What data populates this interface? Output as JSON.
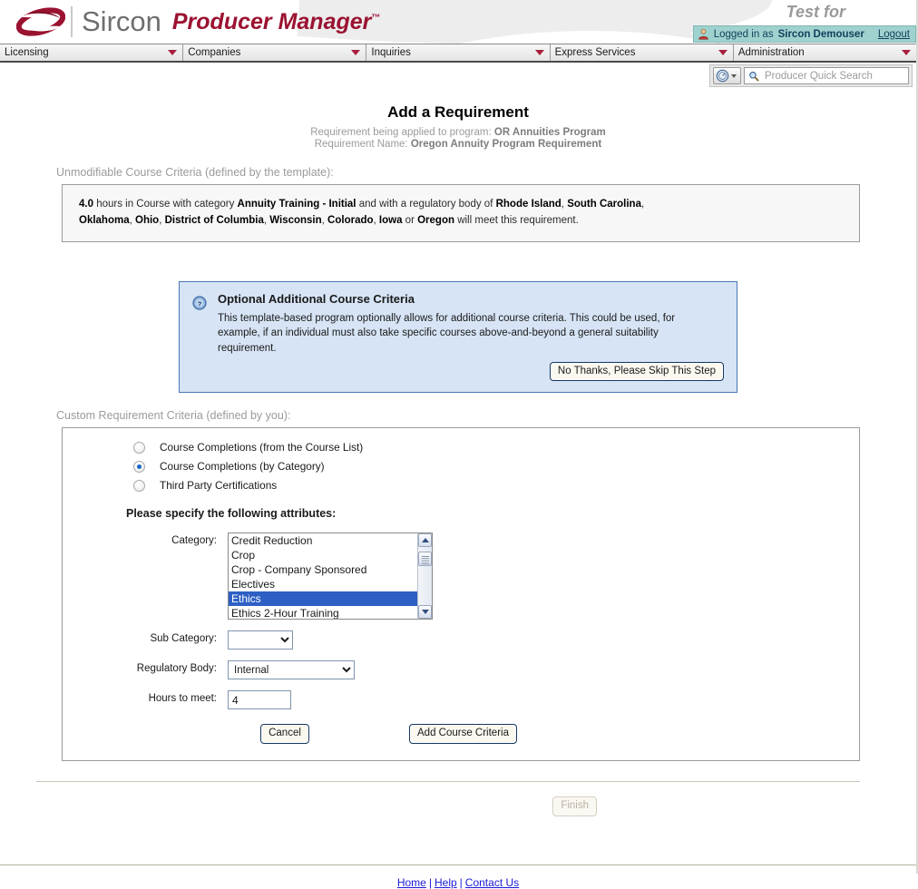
{
  "header": {
    "logo_brand": "Sircon",
    "logo_product": "Producer Manager",
    "logo_tm": "™",
    "logo_icon": "sircon-swoosh-logo",
    "test_for": "Test for",
    "logged_in_prefix": "Logged in as",
    "logged_in_user": "Sircon Demouser",
    "logout_label": "Logout",
    "person_icon": "user-icon"
  },
  "nav": {
    "items": [
      {
        "label": "Licensing"
      },
      {
        "label": "Companies"
      },
      {
        "label": "Inquiries"
      },
      {
        "label": "Express Services"
      },
      {
        "label": "Administration"
      }
    ]
  },
  "quick_search": {
    "globe_icon": "globe-icon",
    "search_icon": "search-icon",
    "placeholder": "Producer Quick Search",
    "value": ""
  },
  "page": {
    "title": "Add a Requirement",
    "subtitle_1_prefix": "Requirement being applied to program:",
    "subtitle_1_value": "OR Annuities Program",
    "subtitle_2_prefix": "Requirement Name:",
    "subtitle_2_value": "Oregon Annuity Program Requirement"
  },
  "unmodifiable": {
    "section_label": "Unmodifiable Course Criteria (defined by the template):",
    "line1_a": "4.0",
    "line1_b": " hours in Course with category ",
    "line1_c": "Annuity Training - Initial",
    "line1_d": " and with a regulatory body of ",
    "line1_e": "Rhode Island",
    "line1_f": ", ",
    "line1_g": "South Carolina",
    "line2_a": "Oklahoma",
    "line2_b": "Ohio",
    "line2_c": "District of Columbia",
    "line2_d": "Wisconsin",
    "line2_e": "Colorado",
    "line2_f": "Iowa",
    "line2_g": " or ",
    "line2_h": "Oregon",
    "line2_i": " will meet this requirement."
  },
  "info_panel": {
    "icon": "help-circle-icon",
    "title": "Optional Additional Course Criteria",
    "text": "This template-based program optionally allows for additional course criteria. This could be used, for example, if an individual must also take specific courses above-and-beyond a general suitability requirement.",
    "skip_button": "No Thanks, Please Skip This Step",
    "bg_color": "#d6e4f5",
    "border_color": "#4a77b5"
  },
  "custom": {
    "section_label": "Custom Requirement Criteria (defined by you):",
    "radios": [
      {
        "label": "Course Completions (from the Course List)",
        "checked": false
      },
      {
        "label": "Course Completions (by Category)",
        "checked": true
      },
      {
        "label": "Third Party Certifications",
        "checked": false
      }
    ],
    "attrs_title": "Please specify the following attributes:",
    "category": {
      "label": "Category:",
      "options": [
        "Credit Reduction",
        "Crop",
        "Crop - Company Sponsored",
        "Electives",
        "Ethics",
        "Ethics 2-Hour Training"
      ],
      "selected": "Ethics",
      "selected_color": "#2d5fc4"
    },
    "sub_category": {
      "label": "Sub Category:",
      "value": "",
      "options": [
        ""
      ]
    },
    "regulatory_body": {
      "label": "Regulatory Body:",
      "value": "Internal",
      "options": [
        "Internal"
      ]
    },
    "hours": {
      "label": "Hours to meet:",
      "value": "4"
    },
    "cancel_button": "Cancel",
    "add_button": "Add Course Criteria"
  },
  "footer": {
    "finish_button": "Finish",
    "finish_disabled": true,
    "links": [
      "Home",
      "Help",
      "Contact Us"
    ],
    "separator": "|"
  }
}
